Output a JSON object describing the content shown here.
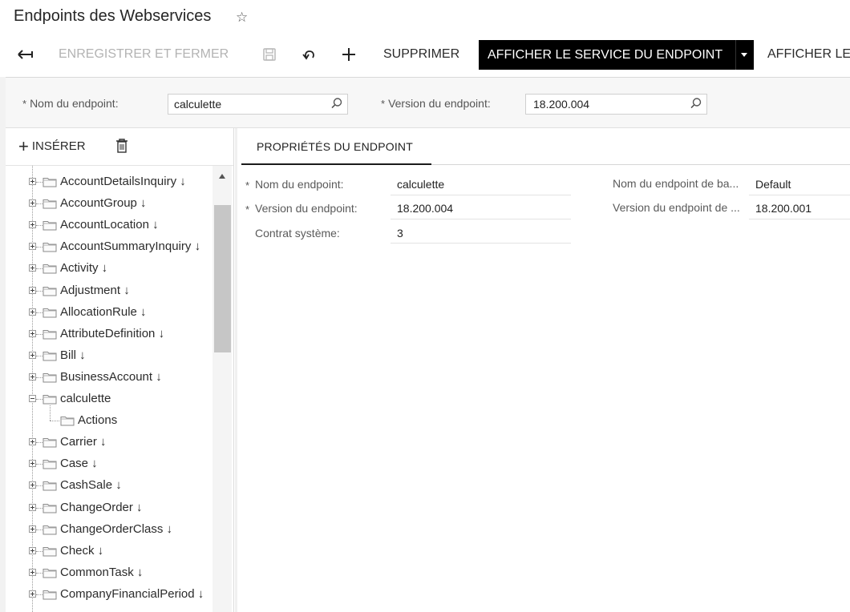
{
  "page": {
    "title": "Endpoints des Webservices"
  },
  "toolbar": {
    "save_close": "ENREGISTRER ET FERMER",
    "delete": "SUPPRIMER",
    "show_service": "AFFICHER LE SERVICE DU ENDPOINT",
    "show_more": "AFFICHER LE"
  },
  "filter": {
    "endpoint_name_label": "Nom du endpoint:",
    "endpoint_name_value": "calculette",
    "endpoint_version_label": "Version du endpoint:",
    "endpoint_version_value": "18.200.004",
    "required_mark": "*"
  },
  "tree_toolbar": {
    "insert": "INSÉRER"
  },
  "tree": {
    "items": [
      {
        "label": "AccountDetailsInquiry ↓"
      },
      {
        "label": "AccountGroup ↓"
      },
      {
        "label": "AccountLocation ↓"
      },
      {
        "label": "AccountSummaryInquiry ↓"
      },
      {
        "label": "Activity ↓"
      },
      {
        "label": "Adjustment ↓"
      },
      {
        "label": "AllocationRule ↓"
      },
      {
        "label": "AttributeDefinition ↓"
      },
      {
        "label": "Bill ↓"
      },
      {
        "label": "BusinessAccount ↓"
      },
      {
        "label": "calculette"
      },
      {
        "label": "Actions"
      },
      {
        "label": "Carrier ↓"
      },
      {
        "label": "Case ↓"
      },
      {
        "label": "CashSale ↓"
      },
      {
        "label": "ChangeOrder ↓"
      },
      {
        "label": "ChangeOrderClass ↓"
      },
      {
        "label": "Check ↓"
      },
      {
        "label": "CommonTask ↓"
      },
      {
        "label": "CompanyFinancialPeriod ↓"
      }
    ]
  },
  "tabs": {
    "properties": "PROPRIÉTÉS DU ENDPOINT"
  },
  "properties": {
    "name_label": "Nom du endpoint:",
    "name_value": "calculette",
    "version_label": "Version du endpoint:",
    "version_value": "18.200.004",
    "contract_label": "Contrat système:",
    "contract_value": "3",
    "base_name_label": "Nom du endpoint de ba...",
    "base_name_value": "Default",
    "base_version_label": "Version du endpoint de ...",
    "base_version_value": "18.200.001"
  }
}
